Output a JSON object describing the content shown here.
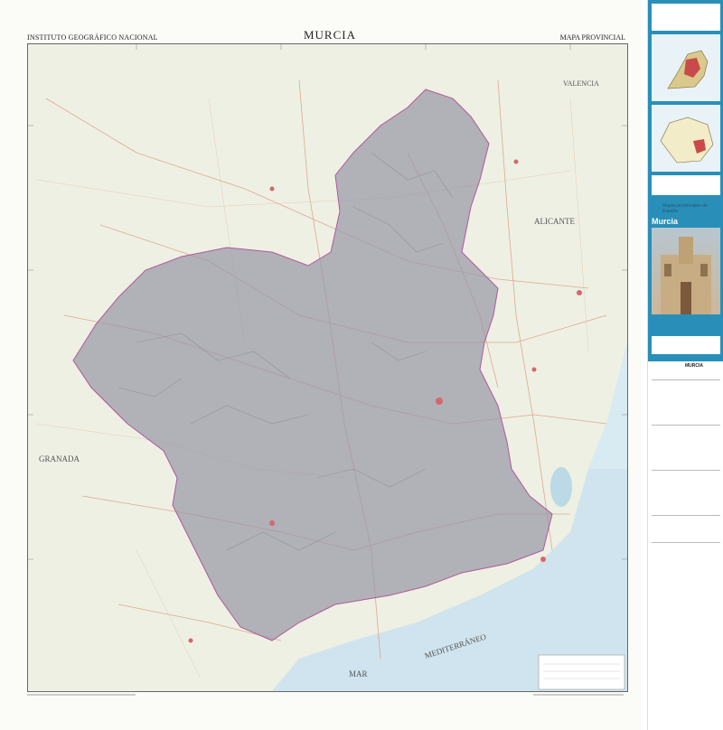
{
  "header": {
    "left": "INSTITUTO GEOGRÁFICO NACIONAL",
    "center": "MURCIA",
    "right": "MAPA PROVINCIAL"
  },
  "map": {
    "place_labels": {
      "valencia": "VALENCIA",
      "alicante": "ALICANTE",
      "granada": "GRANADA",
      "mar": "MAR",
      "mediterraneo": "MEDITERRÁNEO"
    }
  },
  "cover": {
    "series": "Mapas provinciales de España",
    "title": "Murcia"
  },
  "legend": {
    "province": "MURCIA"
  },
  "colors": {
    "province_fill": "#9a98a6",
    "land": "#eef0e4",
    "sea": "#cfe4ee",
    "cover_blue": "#2a8fb8",
    "roads": "#d98a6c"
  }
}
